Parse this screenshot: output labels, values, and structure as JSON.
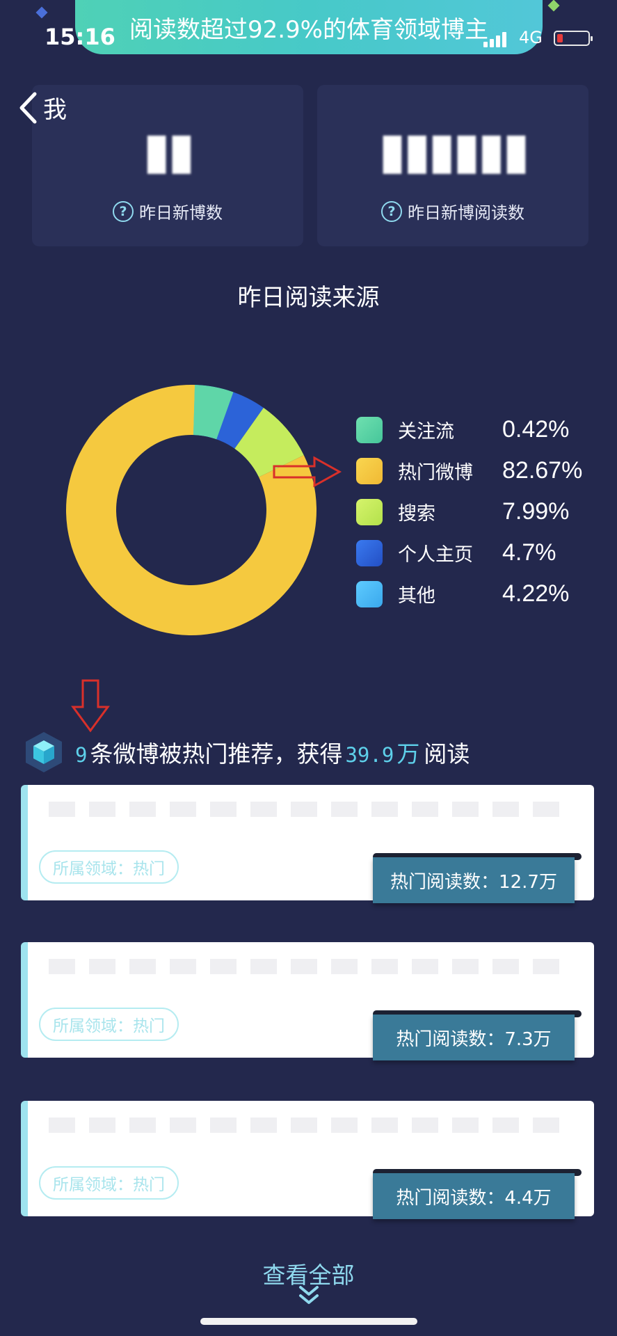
{
  "status_bar": {
    "time": "15:16",
    "network": "4G"
  },
  "banner": {
    "text": "阅读数超过92.9%的体育领域博主"
  },
  "header": {
    "back_label": "我"
  },
  "stats": [
    {
      "caption": "昨日新博数"
    },
    {
      "caption": "昨日新博阅读数"
    }
  ],
  "reading_sources": {
    "title": "昨日阅读来源",
    "chart_data": {
      "type": "pie",
      "style": "donut",
      "categories": [
        "关注流",
        "热门微博",
        "搜索",
        "个人主页",
        "其他"
      ],
      "values": [
        0.42,
        82.67,
        7.99,
        4.7,
        4.22
      ],
      "labels": [
        "0.42%",
        "82.67%",
        "7.99%",
        "4.7%",
        "4.22%"
      ],
      "colors": [
        "#5fd6a8",
        "#f5c93f",
        "#c5ec5d",
        "#2c63d8",
        "#4cbcf6"
      ],
      "unit": "%",
      "legend_position": "right"
    }
  },
  "promo": {
    "count": "9",
    "pre": "条微博被热门推荐，获得",
    "reads": "39.9",
    "unit": "万",
    "post": "阅读"
  },
  "posts": [
    {
      "tag": "所属领域：热门",
      "reads": "热门阅读数：12.7万"
    },
    {
      "tag": "所属领域：热门",
      "reads": "热门阅读数：7.3万"
    },
    {
      "tag": "所属领域：热门",
      "reads": "热门阅读数：4.4万"
    }
  ],
  "footer": {
    "view_all": "查看全部"
  },
  "colors": {
    "background": "#23284d",
    "card": "#2a3058",
    "accent": "#5ed0ea",
    "annotation_red": "#d9302a"
  }
}
